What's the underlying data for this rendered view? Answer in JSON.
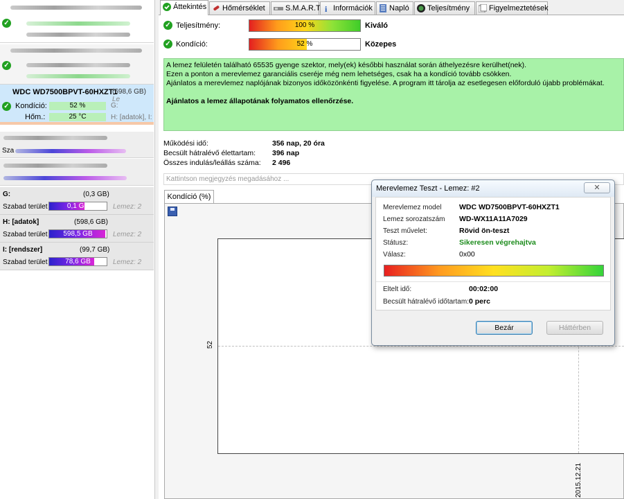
{
  "disks": {
    "selected": {
      "title": "WDC WD7500BPVT-60HXZT1",
      "size": "(698,6 GB)",
      "size_suffix": "Le",
      "condition_label": "Kondíció:",
      "condition_value": "52 %",
      "condition_drive": "G:",
      "temp_label": "Hőm.:",
      "temp_value": "25 °C",
      "temp_drive": "H: [adatok], I:"
    },
    "blurred_label": "Sza"
  },
  "drives": [
    {
      "name": "G:",
      "capacity": "(0,3 GB)",
      "free_label": "Szabad terület",
      "free": "0,1 GB",
      "used_fraction": 0.62,
      "disk": "Lemez: 2"
    },
    {
      "name": "H: [adatok]",
      "capacity": "(598,6 GB)",
      "free_label": "Szabad terület",
      "free": "598,5 GB",
      "used_fraction": 0.98,
      "disk": "Lemez: 2"
    },
    {
      "name": "I: [rendszer]",
      "capacity": "(99,7 GB)",
      "free_label": "Szabad terület",
      "free": "78,6 GB",
      "used_fraction": 0.78,
      "disk": "Lemez: 2"
    }
  ],
  "tabs": [
    {
      "label": "Áttekintés",
      "icon": "check-circle-icon",
      "active": true
    },
    {
      "label": "Hőmérséklet",
      "icon": "thermometer-icon"
    },
    {
      "label": "S.M.A.R.T.",
      "icon": "smart-icon"
    },
    {
      "label": "Információk",
      "icon": "info-icon"
    },
    {
      "label": "Napló",
      "icon": "log-icon"
    },
    {
      "label": "Teljesítmény",
      "icon": "performance-icon"
    },
    {
      "label": "Figyelmeztetések",
      "icon": "alerts-icon"
    }
  ],
  "overview": {
    "performance_label": "Teljesítmény:",
    "performance_value": "100 %",
    "performance_fraction": 1.0,
    "performance_rating": "Kiváló",
    "condition_label": "Kondíció:",
    "condition_value": "52 %",
    "condition_fraction": 0.52,
    "condition_rating": "Közepes",
    "message_lines": [
      "A lemez felületén található 65535 gyenge szektor, mely(ek) későbbi használat során áthelyezésre kerülhet(nek).",
      "Ezen a ponton a merevlemez garanciális cseréje még nem lehetséges, csak ha a kondíció tovább csökken.",
      "Ajánlatos a merevlemez naplójának bizonyos időközönkénti figyelése. A program itt tárolja az esetlegesen előforduló újabb problémákat."
    ],
    "message_recommendation": "Ajánlatos a lemez állapotának folyamatos ellenőrzése.",
    "uptime_label": "Működési idő:",
    "uptime_value": "356 nap, 20 óra",
    "remaining_label": "Becsült hátralévő élettartam:",
    "remaining_value": "396 nap",
    "startstop_label": "Összes indulás/leállás száma:",
    "startstop_value": "2 496",
    "note_placeholder": "Kattintson megjegyzés megadásához ...",
    "chart_tab": "Kondíció  (%)",
    "chart_y_tick": "52",
    "chart_x_tick": "2015.12.21"
  },
  "dialog": {
    "title": "Merevlemez Teszt - Lemez: #2",
    "model_label": "Merevlemez model",
    "model_value": "WDC WD7500BPVT-60HXZT1",
    "serial_label": "Lemez sorozatszám",
    "serial_value": "WD-WX11A11A7029",
    "operation_label": "Teszt művelet:",
    "operation_value": "Rövid ön-teszt",
    "status_label": "Státusz:",
    "status_value": "Sikeresen végrehajtva",
    "reply_label": "Válasz:",
    "reply_value": "0x00",
    "elapsed_label": "Eltelt idő:",
    "elapsed_value": "00:02:00",
    "remaining_label": "Becsült hátralévő időtartam:",
    "remaining_value": "0 perc",
    "close_button": "Bezár",
    "background_button": "Háttérben",
    "progress_fraction": 1.0
  }
}
